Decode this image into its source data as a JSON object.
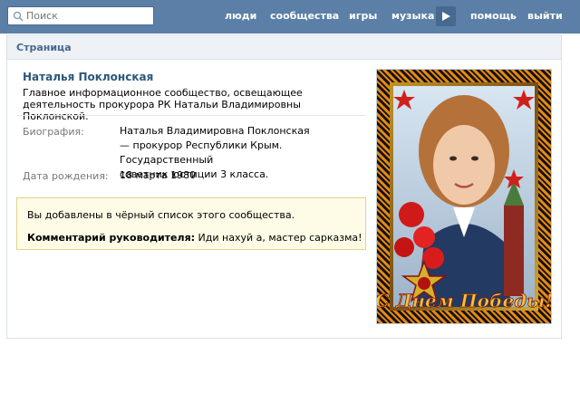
{
  "search": {
    "placeholder": "Поиск"
  },
  "nav": {
    "people": "люди",
    "communities": "сообщества",
    "games": "игры",
    "music": "музыка",
    "help": "помощь",
    "logout": "выйти"
  },
  "page": {
    "header": "Страница",
    "title": "Наталья Поклонская",
    "description": "Главное информационное сообщество, освещающее деятельность прокурора РК Натальи Владимировны Поклонской."
  },
  "info": {
    "bio_label": "Биография:",
    "bio_lines": [
      "Наталья Владимировна Поклонская",
      "— прокурор Республики Крым. Государственный",
      "советник юстиции 3 класса."
    ],
    "birth_label": "Дата рождения:",
    "birth_value": "18 марта 1980"
  },
  "notice": {
    "text": "Вы добавлены в чёрный список этого сообщества.",
    "comment_label": "Комментарий руководителя:",
    "comment_text": "Иди нахуй а, мастер сарказма!"
  },
  "photo": {
    "caption": "С Днем Победы!"
  },
  "colors": {
    "topbar": "#5b7fa6",
    "link": "#2b587a",
    "notice_bg": "#fefbe6"
  }
}
